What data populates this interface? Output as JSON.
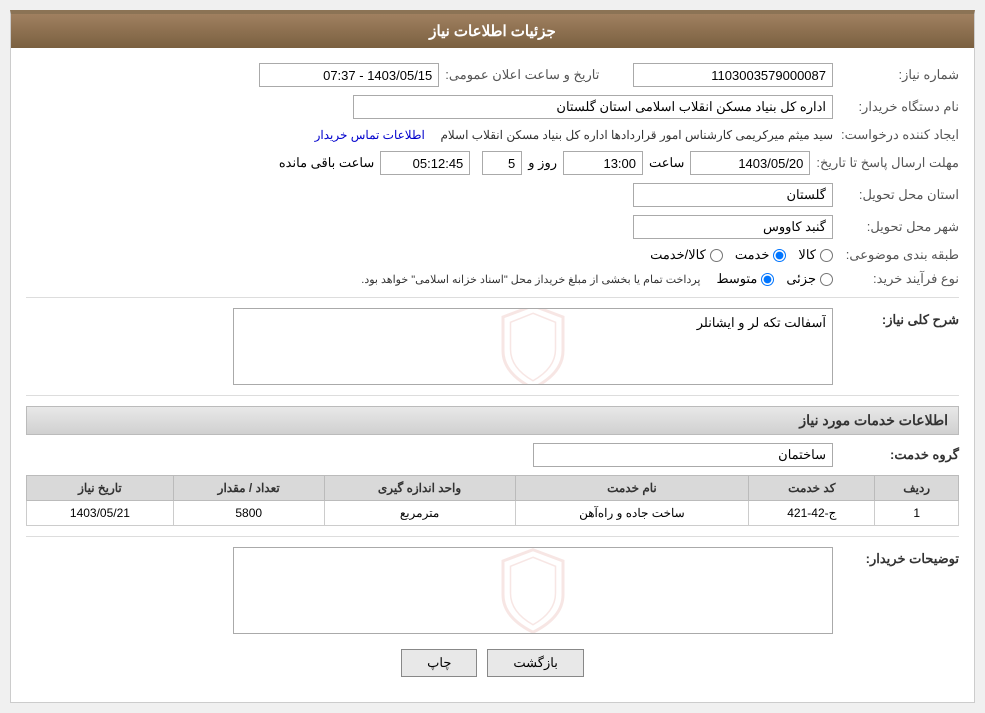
{
  "header": {
    "title": "جزئیات اطلاعات نیاز"
  },
  "fields": {
    "need_number_label": "شماره نیاز:",
    "need_number_value": "1103003579000087",
    "buyer_org_label": "نام دستگاه خریدار:",
    "buyer_org_value": "اداره کل بنیاد مسکن انقلاب اسلامی استان گلستان",
    "creator_label": "ایجاد کننده درخواست:",
    "creator_value": "سید میثم میرکریمی کارشناس امور قراردادها اداره کل بنیاد مسکن انقلاب اسلام",
    "creator_link": "اطلاعات تماس خریدار",
    "pub_date_label": "تاریخ و ساعت اعلان عمومی:",
    "pub_date_value": "1403/05/15 - 07:37",
    "response_deadline_label": "مهلت ارسال پاسخ تا تاریخ:",
    "response_date": "1403/05/20",
    "response_time": "13:00",
    "response_days": "5",
    "response_remaining": "05:12:45",
    "response_remaining_label": "ساعت باقی مانده",
    "days_label": "روز و",
    "time_label": "ساعت",
    "province_label": "استان محل تحویل:",
    "province_value": "گلستان",
    "city_label": "شهر محل تحویل:",
    "city_value": "گنبد کاووس",
    "category_label": "طبقه بندی موضوعی:",
    "category_options": [
      {
        "label": "کالا",
        "value": "kala"
      },
      {
        "label": "خدمت",
        "value": "khedmat"
      },
      {
        "label": "کالا/خدمت",
        "value": "both"
      }
    ],
    "category_selected": "khedmat",
    "purchase_type_label": "نوع فرآیند خرید:",
    "purchase_type_options": [
      {
        "label": "جزئی",
        "value": "jozei"
      },
      {
        "label": "متوسط",
        "value": "motavaset"
      }
    ],
    "purchase_type_selected": "motavaset",
    "purchase_type_note": "پرداخت تمام یا بخشی از مبلغ خریداز محل \"اسناد خزانه اسلامی\" خواهد بود.",
    "general_description_label": "شرح کلی نیاز:",
    "general_description_value": "آسفالت تکه لر و ایشانلر",
    "services_section_title": "اطلاعات خدمات مورد نیاز",
    "service_group_label": "گروه خدمت:",
    "service_group_value": "ساختمان",
    "table_headers": {
      "row_num": "ردیف",
      "service_code": "کد خدمت",
      "service_name": "نام خدمت",
      "unit": "واحد اندازه گیری",
      "quantity": "تعداد / مقدار",
      "need_date": "تاریخ نیاز"
    },
    "table_rows": [
      {
        "row_num": "1",
        "service_code": "ج-42-421",
        "service_name": "ساخت جاده و راه‌آهن",
        "unit": "مترمربع",
        "quantity": "5800",
        "need_date": "1403/05/21"
      }
    ],
    "buyer_notes_label": "توضیحات خریدار:",
    "buyer_notes_value": "",
    "btn_print": "چاپ",
    "btn_back": "بازگشت"
  }
}
